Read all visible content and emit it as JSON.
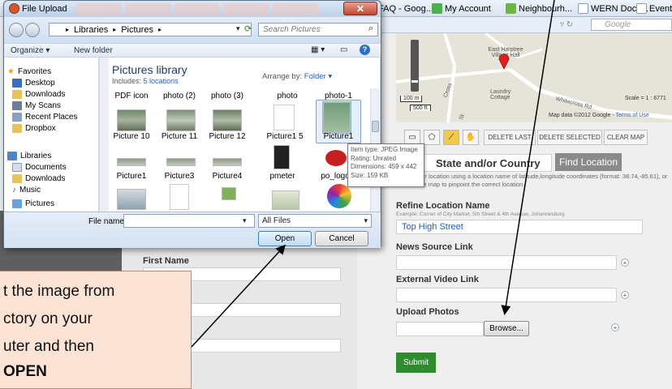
{
  "bookmarks": [
    {
      "label": "FAQ - Goog...",
      "color": "#f2a74a"
    },
    {
      "label": "My Account",
      "color": "#4caf50"
    },
    {
      "label": "Neighbourh...",
      "color": "#6bb83f"
    },
    {
      "label": "WERN Docs...",
      "color": "#8a9bb3"
    },
    {
      "label": "Event",
      "color": "#ffffff"
    }
  ],
  "browser": {
    "search_placeholder": "Google"
  },
  "dialog": {
    "title": "File Upload",
    "breadcrumb": [
      "Libraries",
      "Pictures"
    ],
    "search_placeholder": "Search Pictures",
    "toolbar": {
      "organize": "Organize ▾",
      "new_folder": "New folder"
    },
    "nav": {
      "favorites": [
        "Favorites",
        "Desktop",
        "Downloads",
        "My Scans",
        "Recent Places",
        "Dropbox"
      ],
      "libraries": [
        "Libraries",
        "Documents",
        "Downloads",
        "Music",
        "Pictures"
      ]
    },
    "library_title": "Pictures library",
    "includes": "Includes:",
    "includes_link": "5 locations",
    "arrange_by": "Arrange by:",
    "arrange_value": "Folder ▾",
    "folders": [
      "PDF icon",
      "photo (2)",
      "photo (3)",
      "photo",
      "photo-1"
    ],
    "row2": [
      "Picture 10",
      "Picture 11",
      "Picture 12",
      "Picture1 5",
      "Picture1"
    ],
    "row3": [
      "Picture1",
      "Picture3",
      "Picture4",
      "pmeter",
      "po_logo"
    ],
    "file_name_label": "File name:",
    "file_type": "All Files",
    "open": "Open",
    "cancel": "Cancel"
  },
  "tooltip": {
    "type": "Item type: JPEG Image",
    "rating": "Rating: Unrated",
    "dimensions": "Dimensions: 459 x 442",
    "size": "Size: 159 KB"
  },
  "map": {
    "place": "East Harptree Village Hall",
    "cottage": "Laundry Cottage",
    "scale_m": "100 m",
    "scale_ft": "500 ft",
    "scale_ratio": "Scale = 1 : 6771",
    "attribution": "Map data ©2012 Google -",
    "terms": "Terms of Use",
    "road1": "Whitecross Rd",
    "road2": "Cross",
    "road3": "St"
  },
  "map_tools": {
    "delete_last": "DELETE LAST",
    "delete_selected": "DELETE SELECTED",
    "clear_map": "CLEAR MAP"
  },
  "location": {
    "value": "State and/or Country",
    "find": "Find Location",
    "help": "...h for your location using a location name of latitude,longitude coordinates (format: 38.74,-85.61), or click on the map to pinpoint the correct location."
  },
  "form": {
    "refine_label": "Refine Location Name",
    "refine_example": "Example: Corner of City Market, 5th Street & 4th Avenue, Johannesburg",
    "refine_value": "Top High Street",
    "news_label": "News Source Link",
    "video_label": "External Video Link",
    "photos_label": "Upload Photos",
    "browse": "Browse...",
    "submit": "Submit",
    "first_name": "First Name"
  },
  "callout": {
    "lines": [
      "t the image from",
      "ctory on your",
      "uter and then",
      "OPEN"
    ]
  }
}
